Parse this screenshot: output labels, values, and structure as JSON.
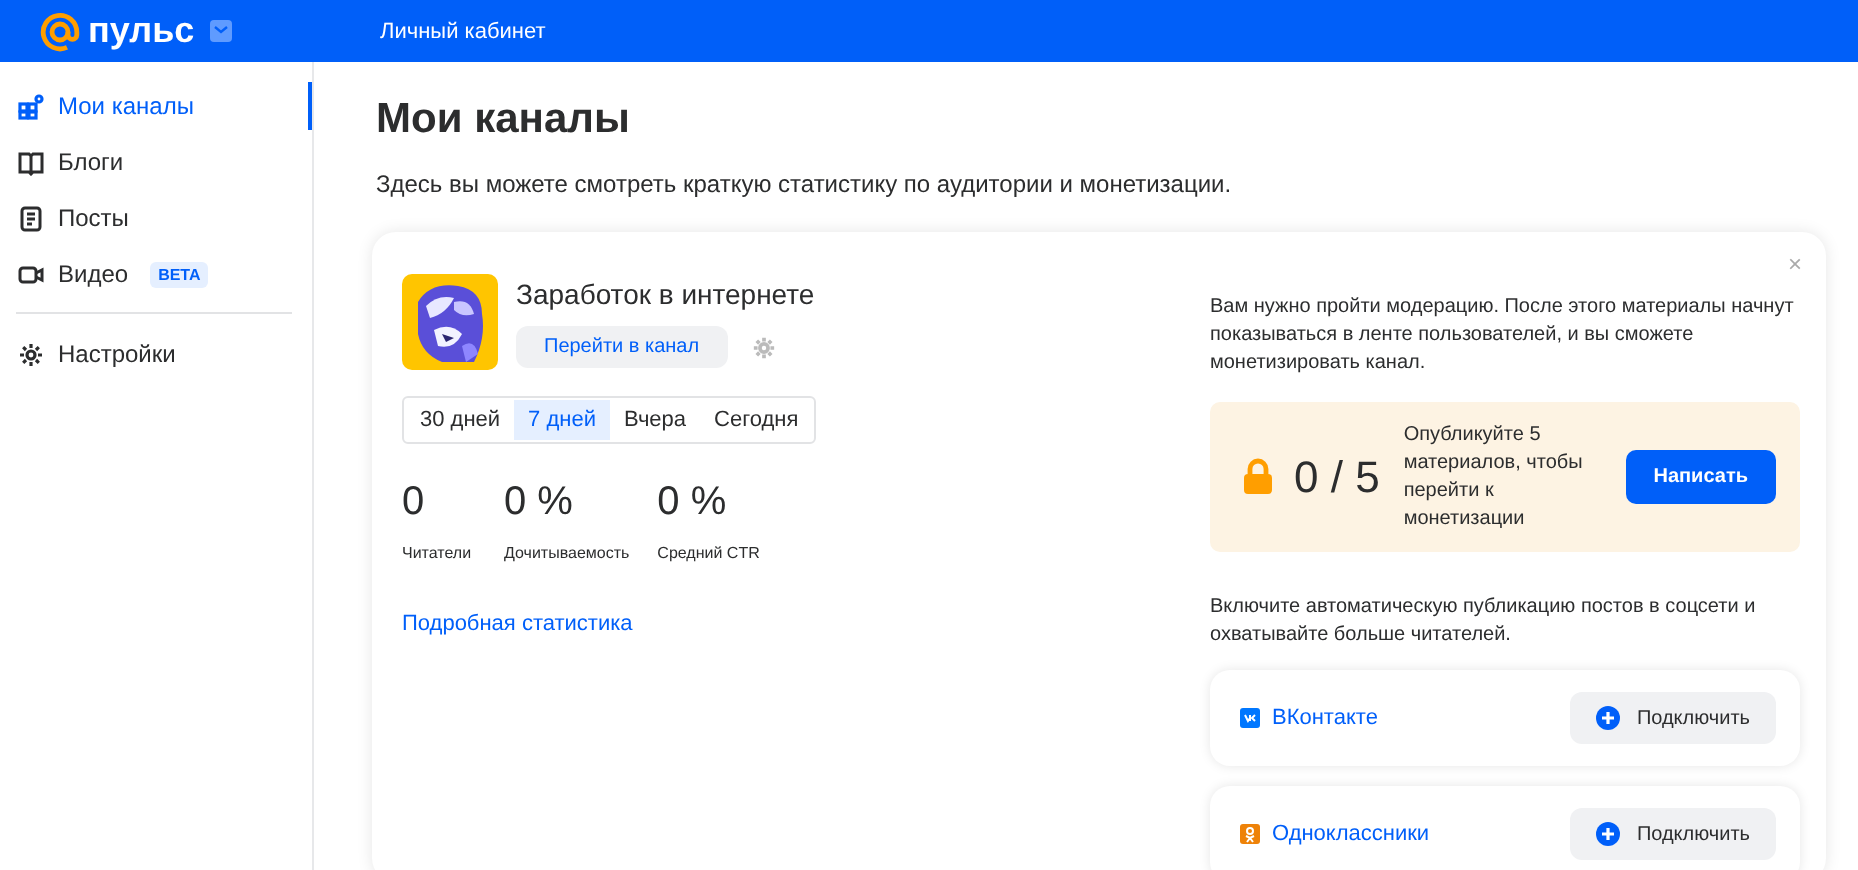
{
  "header": {
    "logo": "пульс",
    "nav": "Личный кабинет"
  },
  "sidebar": {
    "groups": [
      [
        {
          "label": "Мои каналы",
          "selected": true,
          "kind": "channels"
        },
        {
          "label": "Блоги",
          "selected": false,
          "kind": "blogs"
        },
        {
          "label": "Посты",
          "selected": false,
          "kind": "posts"
        },
        {
          "label": "Видео",
          "selected": false,
          "kind": "video",
          "badge": "BETA"
        }
      ],
      [
        {
          "label": "Настройки",
          "selected": false,
          "kind": "settings"
        }
      ]
    ]
  },
  "page": {
    "title": "Мои каналы",
    "subtitle": "Здесь вы можете смотреть краткую статистику по аудитории и монетизации."
  },
  "channel": {
    "name": "Заработок в интернете",
    "goto_button": "Перейти в канал",
    "periods": [
      {
        "label": "30 дней",
        "selected": false
      },
      {
        "label": "7 дней",
        "selected": true
      },
      {
        "label": "Вчера",
        "selected": false
      },
      {
        "label": "Сегодня",
        "selected": false
      }
    ],
    "stats": [
      {
        "value": "0",
        "label": "Читатели"
      },
      {
        "value": "0 %",
        "label": "Дочитываемость"
      },
      {
        "value": "0 %",
        "label": "Средний CTR"
      }
    ],
    "details_link": "Подробная статистика"
  },
  "moderation": {
    "close": "×",
    "text": "Вам нужно пройти модерацию. После этого материалы начнут показываться в ленте пользователей, и вы сможете монетизировать канал.",
    "progress": "0 / 5",
    "progress_text": "Опубликуйте 5 материалов, чтобы перейти к монетизации",
    "write_button": "Написать"
  },
  "autopublish": {
    "text": "Включите автоматическую публикацию постов в соцсети и охватывайте больше читателей.",
    "networks": [
      {
        "name": "ВКонтакте",
        "kind": "vk",
        "connect_button": "Подключить"
      },
      {
        "name": "Одноклассники",
        "kind": "ok",
        "connect_button": "Подключить"
      }
    ]
  }
}
